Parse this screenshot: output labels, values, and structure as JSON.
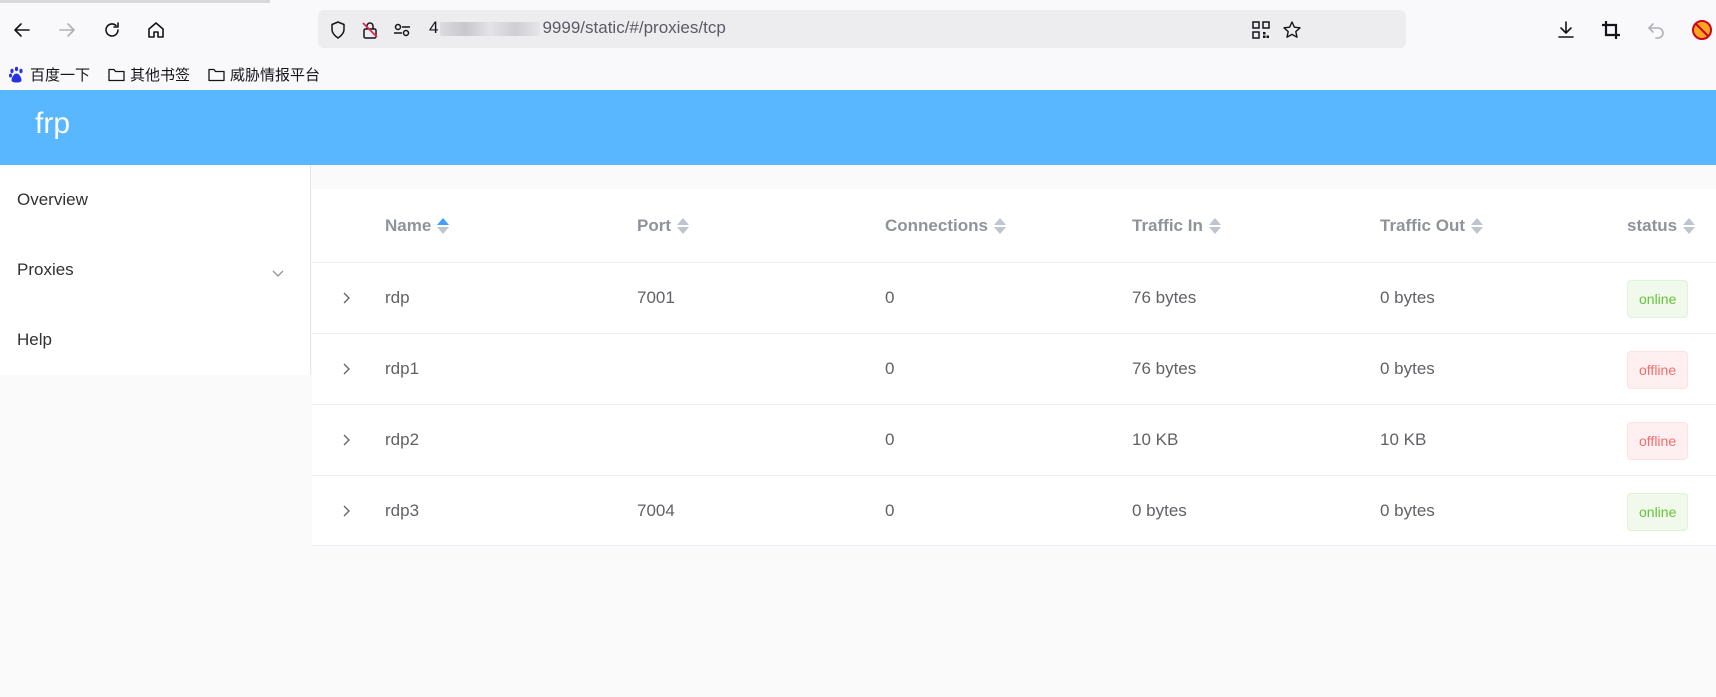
{
  "browser": {
    "url_host_prefix": "4",
    "url_rest": "9999/static/#/proxies/tcp",
    "bookmarks": [
      {
        "label": "百度一下",
        "icon": "baidu-paw-icon"
      },
      {
        "label": "其他书签",
        "icon": "folder-icon"
      },
      {
        "label": "威胁情报平台",
        "icon": "folder-icon"
      }
    ]
  },
  "app": {
    "brand": "frp",
    "header_color": "#58b7ff"
  },
  "sidebar": {
    "items": [
      {
        "label": "Overview"
      },
      {
        "label": "Proxies",
        "has_submenu": true
      },
      {
        "label": "Help"
      }
    ]
  },
  "table": {
    "columns": [
      "Name",
      "Port",
      "Connections",
      "Traffic In",
      "Traffic Out",
      "status"
    ],
    "sorted_column": "Name",
    "rows": [
      {
        "name": "rdp",
        "port": "7001",
        "connections": "0",
        "traffic_in": "76 bytes",
        "traffic_out": "0 bytes",
        "status": "online"
      },
      {
        "name": "rdp1",
        "port": "",
        "connections": "0",
        "traffic_in": "76 bytes",
        "traffic_out": "0 bytes",
        "status": "offline"
      },
      {
        "name": "rdp2",
        "port": "",
        "connections": "0",
        "traffic_in": "10 KB",
        "traffic_out": "10 KB",
        "status": "offline"
      },
      {
        "name": "rdp3",
        "port": "7004",
        "connections": "0",
        "traffic_in": "0 bytes",
        "traffic_out": "0 bytes",
        "status": "online"
      }
    ]
  },
  "colors": {
    "online": "#67c23a",
    "offline": "#f56c6c",
    "sort_active": "#409eff"
  }
}
